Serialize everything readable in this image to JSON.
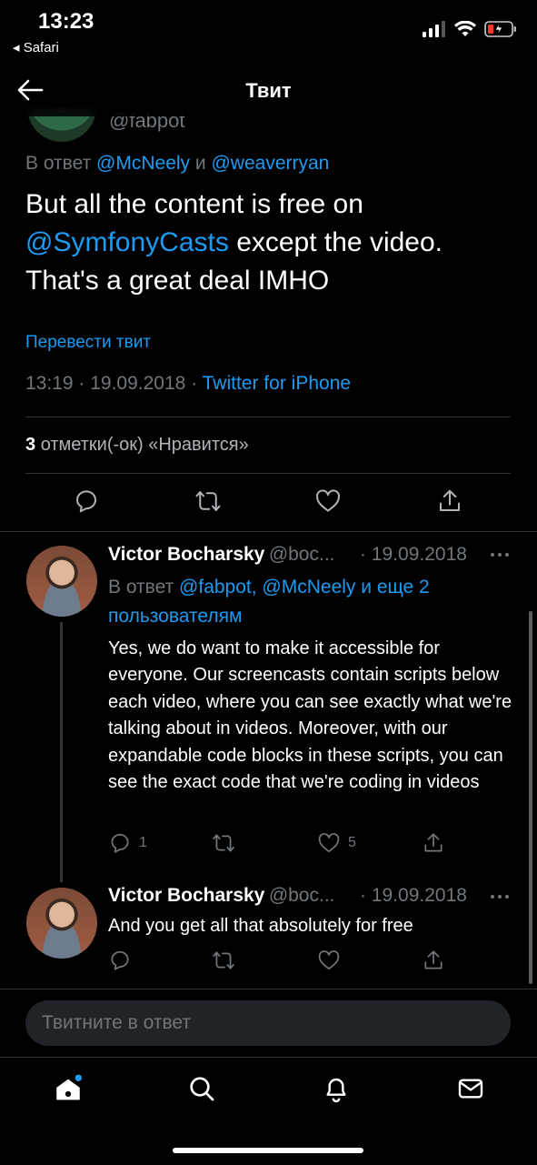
{
  "status": {
    "time": "13:23",
    "back_app": "Safari"
  },
  "header": {
    "title": "Твит"
  },
  "tweet": {
    "handle": "@fabpot",
    "reply_prefix": "В ответ",
    "reply_user1": "@McNeely",
    "reply_and": "и",
    "reply_user2": "@weaverryan",
    "text_part1": "But all the content is free on",
    "text_mention": "@SymfonyCasts",
    "text_part2": "except the video. That's a great deal IMHO",
    "translate": "Перевести твит",
    "time": "13:19",
    "date": "19.09.2018",
    "source": "Twitter for iPhone",
    "likes_count": "3",
    "likes_label": "отметки(-ок) «Нравится»"
  },
  "replies": [
    {
      "name": "Victor Bocharsky",
      "handle": "@boc...",
      "date": "· 19.09.2018",
      "reply_prefix": "В ответ",
      "reply_users": "@fabpot, @McNeely и еще 2 пользователям",
      "text": "Yes, we do want to make it accessible for everyone. Our screencasts contain scripts below each video, where you can see exactly what we're talking about in videos. Moreover, with our expandable code blocks in these scripts, you can see the exact code that we're coding in videos",
      "reply_count": "1",
      "like_count": "5"
    },
    {
      "name": "Victor Bocharsky",
      "handle": "@boc...",
      "date": "· 19.09.2018",
      "text": "And you get all that absolutely for free"
    }
  ],
  "compose": {
    "placeholder": "Твитните в ответ"
  },
  "colors": {
    "accent": "#1d9bf0",
    "background": "#000000",
    "muted": "#71767b",
    "battery_low": "#ff3b30"
  },
  "icons": [
    "back-arrow-icon",
    "reply-icon",
    "retweet-icon",
    "like-icon",
    "share-icon",
    "more-icon",
    "home-icon",
    "search-icon",
    "notifications-icon",
    "messages-icon"
  ]
}
